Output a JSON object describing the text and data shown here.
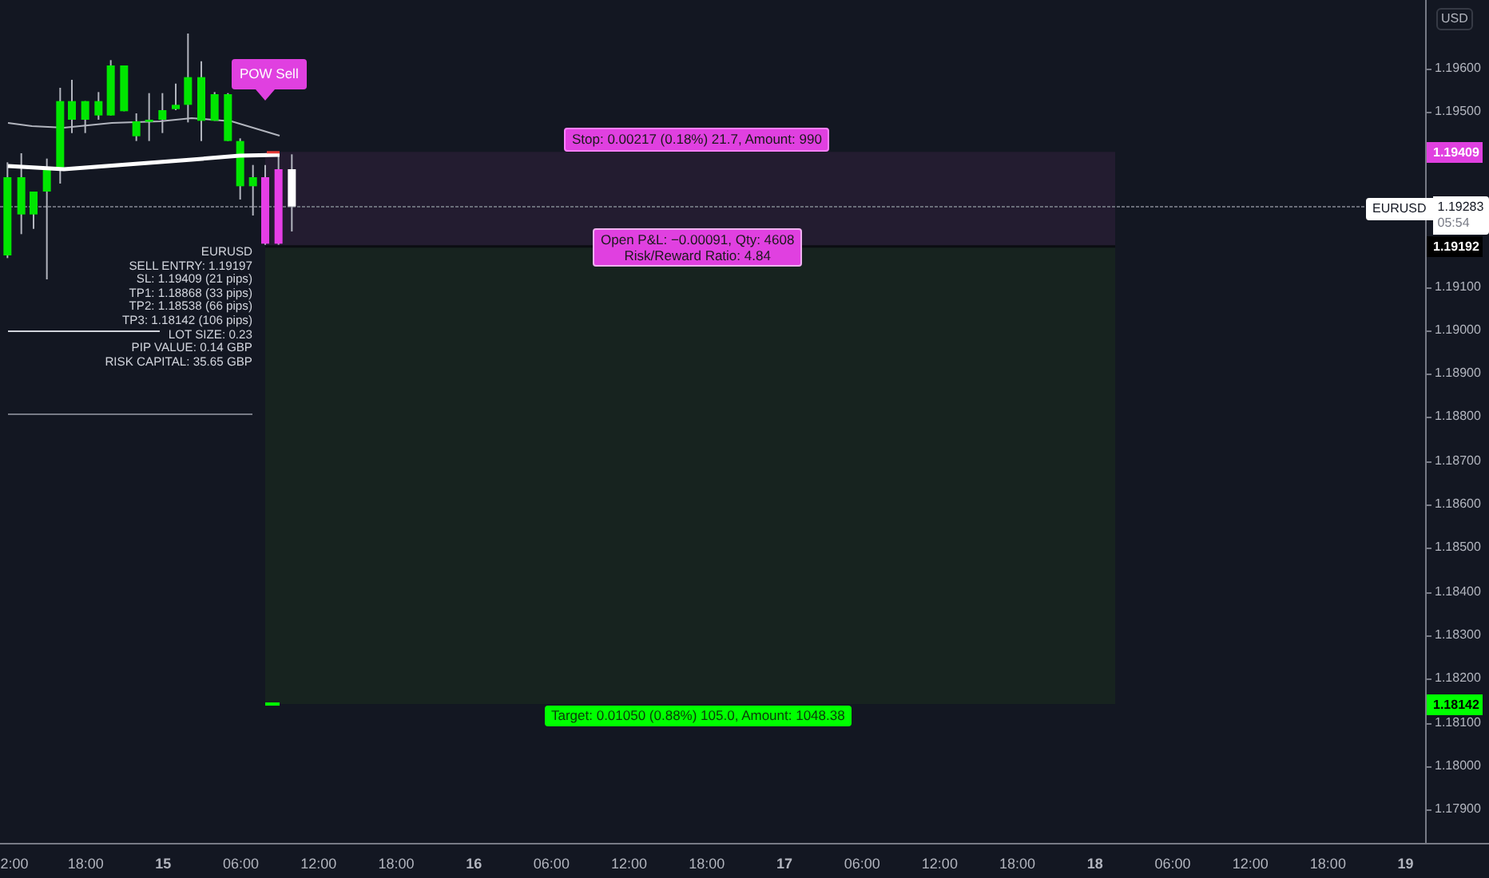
{
  "currency_badge": "USD",
  "price_axis": {
    "ticks": [
      "1.19600",
      "1.19500",
      "1.19100",
      "1.19000",
      "1.18900",
      "1.18800",
      "1.18700",
      "1.18600",
      "1.18500",
      "1.18400",
      "1.18300",
      "1.18200",
      "1.18100",
      "1.18000",
      "1.17900"
    ],
    "labels": [
      {
        "kind": "stop",
        "text": "1.19409"
      },
      {
        "kind": "entry",
        "text": "1.19192"
      },
      {
        "kind": "target",
        "text": "1.18142"
      }
    ]
  },
  "last_price": {
    "symbol": "EURUSD",
    "price": "1.19283",
    "countdown": "05:54"
  },
  "time_axis": [
    {
      "kind": "time",
      "text": "2:00"
    },
    {
      "kind": "time",
      "text": "18:00"
    },
    {
      "kind": "day",
      "text": "15"
    },
    {
      "kind": "time",
      "text": "06:00"
    },
    {
      "kind": "time",
      "text": "12:00"
    },
    {
      "kind": "time",
      "text": "18:00"
    },
    {
      "kind": "day",
      "text": "16"
    },
    {
      "kind": "time",
      "text": "06:00"
    },
    {
      "kind": "time",
      "text": "12:00"
    },
    {
      "kind": "time",
      "text": "18:00"
    },
    {
      "kind": "day",
      "text": "17"
    },
    {
      "kind": "time",
      "text": "06:00"
    },
    {
      "kind": "time",
      "text": "12:00"
    },
    {
      "kind": "time",
      "text": "18:00"
    },
    {
      "kind": "day",
      "text": "18"
    },
    {
      "kind": "time",
      "text": "06:00"
    },
    {
      "kind": "time",
      "text": "12:00"
    },
    {
      "kind": "time",
      "text": "18:00"
    },
    {
      "kind": "day",
      "text": "19"
    }
  ],
  "signal_label": "POW Sell",
  "position": {
    "stop_label": "Stop: 0.00217 (0.18%) 21.7, Amount: 990",
    "pnl_label": [
      "Open P&L: −0.00091, Qty: 4608",
      "Risk/Reward Ratio: 4.84"
    ],
    "target_label": "Target: 0.01050 (0.88%) 105.0, Amount: 1048.38"
  },
  "info_panel": [
    "EURUSD",
    "SELL ENTRY: 1.19197",
    "SL: 1.19409 (21 pips)",
    "TP1: 1.18868 (33 pips)",
    "TP2: 1.18538 (66 pips)",
    "TP3: 1.18142 (106 pips)",
    "LOT SIZE: 0.23",
    "PIP VALUE: 0.14 GBP",
    "RISK CAPITAL: 35.65 GBP"
  ]
}
